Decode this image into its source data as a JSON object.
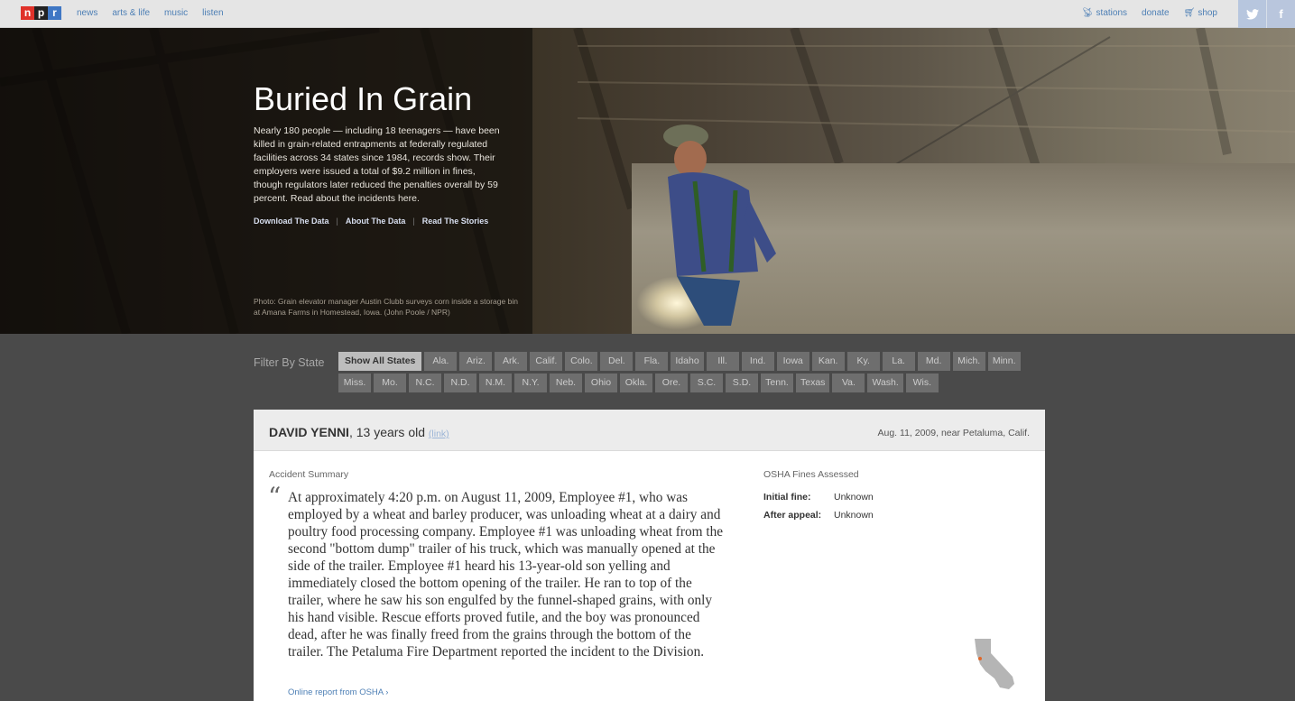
{
  "nav": {
    "logo": [
      "n",
      "p",
      "r"
    ],
    "links": [
      "news",
      "arts & life",
      "music",
      "listen"
    ],
    "right_links": [
      {
        "icon": "radio-tower-icon",
        "label": "stations"
      },
      {
        "icon": "",
        "label": "donate"
      },
      {
        "icon": "cart-icon",
        "label": "shop"
      }
    ],
    "social": {
      "twitter": "t",
      "facebook": "f"
    }
  },
  "hero": {
    "title": "Buried In Grain",
    "body": "Nearly 180 people — including 18 teenagers — have been killed in grain-related entrapments at federally regulated facilities across 34 states since 1984, records show. Their employers were issued a total of $9.2 million in fines, though regulators later reduced the penalties overall by 59 percent. Read about the incidents here.",
    "links": [
      "Download The Data",
      "About The Data",
      "Read The Stories"
    ],
    "separator": "|",
    "credit": "Photo: Grain elevator manager Austin Clubb surveys corn inside a storage bin at Amana Farms in Homestead, Iowa. (John Poole / NPR)"
  },
  "filter": {
    "label": "Filter By State",
    "states": [
      "Show All States",
      "Ala.",
      "Ariz.",
      "Ark.",
      "Calif.",
      "Colo.",
      "Del.",
      "Fla.",
      "Idaho",
      "Ill.",
      "Ind.",
      "Iowa",
      "Kan.",
      "Ky.",
      "La.",
      "Md.",
      "Mich.",
      "Minn.",
      "Miss.",
      "Mo.",
      "N.C.",
      "N.D.",
      "N.M.",
      "N.Y.",
      "Neb.",
      "Ohio",
      "Okla.",
      "Ore.",
      "S.C.",
      "S.D.",
      "Tenn.",
      "Texas",
      "Va.",
      "Wash.",
      "Wis."
    ],
    "selected": "Show All States"
  },
  "card": {
    "name": "DAVID YENNI",
    "age": ", 13 years old",
    "link": "(link)",
    "date": "Aug. 11, 2009, near Petaluma, Calif.",
    "summary_label": "Accident Summary",
    "quote_mark": "“",
    "summary": "At approximately 4:20 p.m. on August 11, 2009, Employee #1, who was employed by a wheat and barley producer, was unloading wheat at a dairy and poultry food processing company. Employee #1 was unloading wheat from the second \"bottom dump\" trailer of his truck, which was manually opened at the side of the trailer. Employee #1 heard his 13-year-old son yelling and immediately closed the bottom opening of the trailer. He ran to top of the trailer, where he saw his son engulfed by the funnel-shaped grains, with only his hand visible. Rescue efforts proved futile, and the boy was pronounced dead, after he was finally freed from the grains through the bottom of the trailer. The Petaluma Fire Department reported the incident to the Division.",
    "osha_link": "Online report from OSHA ›",
    "fines_label": "OSHA Fines Assessed",
    "initial_label": "Initial fine:",
    "initial_value": "Unknown",
    "appeal_label": "After appeal:",
    "appeal_value": "Unknown",
    "map_state": "california-map"
  },
  "colors": {
    "accent": "#4d7fb5",
    "marker": "#e0682a"
  }
}
